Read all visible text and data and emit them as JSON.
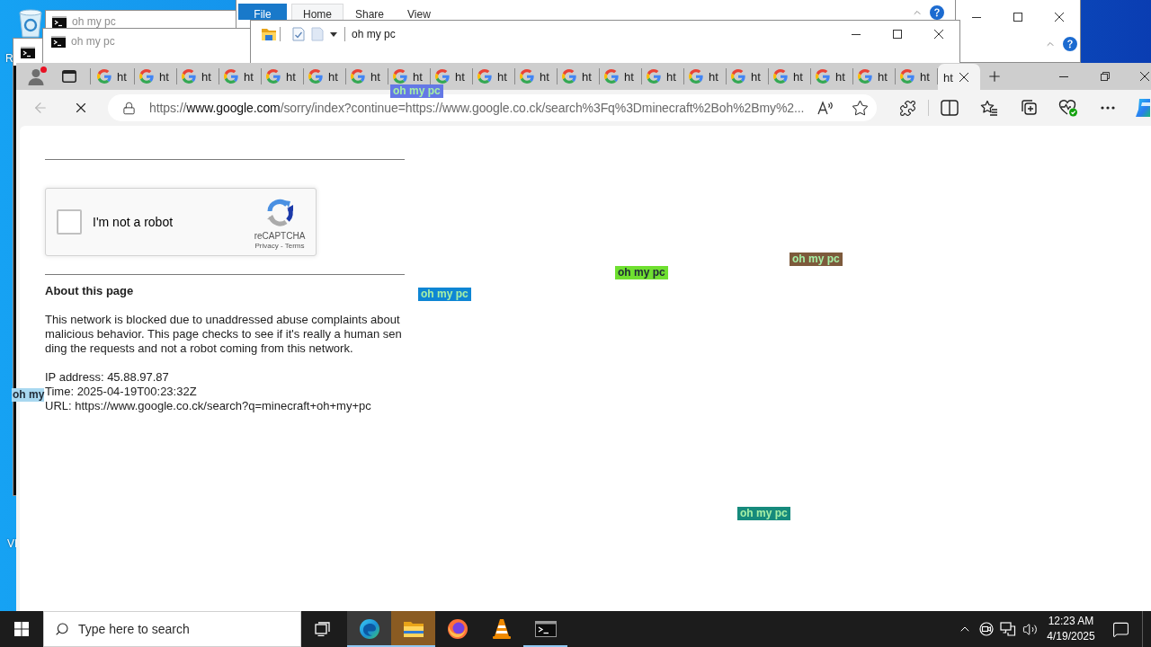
{
  "desktop_icon_labels": [
    "R",
    "VI"
  ],
  "console_windows": [
    {
      "title": "oh my pc"
    },
    {
      "title": "oh my pc"
    }
  ],
  "explorer_back_window": {
    "ribbon_tabs": [
      {
        "kind": "file",
        "label": "File",
        "selected": false
      },
      {
        "kind": "tab",
        "label": "Home",
        "selected": true
      },
      {
        "kind": "tab",
        "label": "Share",
        "selected": false
      },
      {
        "kind": "tab",
        "label": "View",
        "selected": false
      }
    ]
  },
  "explorer_front_window": {
    "title": "oh my pc"
  },
  "browser": {
    "profile_alert": true,
    "tabs": [
      {
        "label": "ht",
        "selected": false
      },
      {
        "label": "ht",
        "selected": false
      },
      {
        "label": "ht",
        "selected": false
      },
      {
        "label": "ht",
        "selected": false
      },
      {
        "label": "ht",
        "selected": false
      },
      {
        "label": "ht",
        "selected": false
      },
      {
        "label": "ht",
        "selected": false
      },
      {
        "label": "ht",
        "selected": false
      },
      {
        "label": "ht",
        "selected": false
      },
      {
        "label": "ht",
        "selected": false
      },
      {
        "label": "ht",
        "selected": false
      },
      {
        "label": "ht",
        "selected": false
      },
      {
        "label": "ht",
        "selected": false
      },
      {
        "label": "ht",
        "selected": false
      },
      {
        "label": "ht",
        "selected": false
      },
      {
        "label": "ht",
        "selected": false
      },
      {
        "label": "ht",
        "selected": false
      },
      {
        "label": "ht",
        "selected": false
      },
      {
        "label": "ht",
        "selected": false
      },
      {
        "label": "ht",
        "selected": false
      },
      {
        "label": "ht",
        "selected": true
      }
    ],
    "back_disabled": true,
    "loading": true,
    "address": {
      "scheme": "https://",
      "host": "www.google.com",
      "rest": "/sorry/index?continue=https://www.google.co.ck/search%3Fq%3Dminecraft%2Boh%2Bmy%2..."
    }
  },
  "page": {
    "captcha": {
      "label": "I'm not a robot",
      "checked": false,
      "brand": "reCAPTCHA",
      "footer": "Privacy - Terms"
    },
    "heading": "About this page",
    "paragraph": "This network is blocked due to unaddressed abuse complaints about malicious behavior. This page checks to see if it's really a human sending the requests and not a robot coming from this network.",
    "details": [
      "IP address: 45.88.97.87",
      "Time: 2025-04-19T00:23:32Z",
      "URL: https://www.google.co.ck/search?q=minecraft+oh+my+pc"
    ]
  },
  "overlay_labels": [
    {
      "text": "oh my pc",
      "color": "#6478e6"
    },
    {
      "text": "oh my pc",
      "color": "#7d5a3c"
    },
    {
      "text": "oh my pc",
      "color": "#6fe030"
    },
    {
      "text": "oh my pc",
      "color": "#0e86d4"
    },
    {
      "text": "oh my",
      "color": "#a8d8f0"
    },
    {
      "text": "oh my pc",
      "color": "#168a7c"
    }
  ],
  "taskbar": {
    "search_placeholder": "Type here to search",
    "apps": [
      {
        "kind": "edge",
        "selected": true,
        "running": true,
        "flashing": false
      },
      {
        "kind": "explorer",
        "selected": false,
        "running": true,
        "flashing": true
      },
      {
        "kind": "firefox",
        "selected": false,
        "running": false,
        "flashing": false
      },
      {
        "kind": "vlc",
        "selected": false,
        "running": false,
        "flashing": false
      },
      {
        "kind": "terminal",
        "selected": false,
        "running": true,
        "flashing": false
      }
    ],
    "time": "12:23 AM",
    "date": "4/19/2025"
  }
}
